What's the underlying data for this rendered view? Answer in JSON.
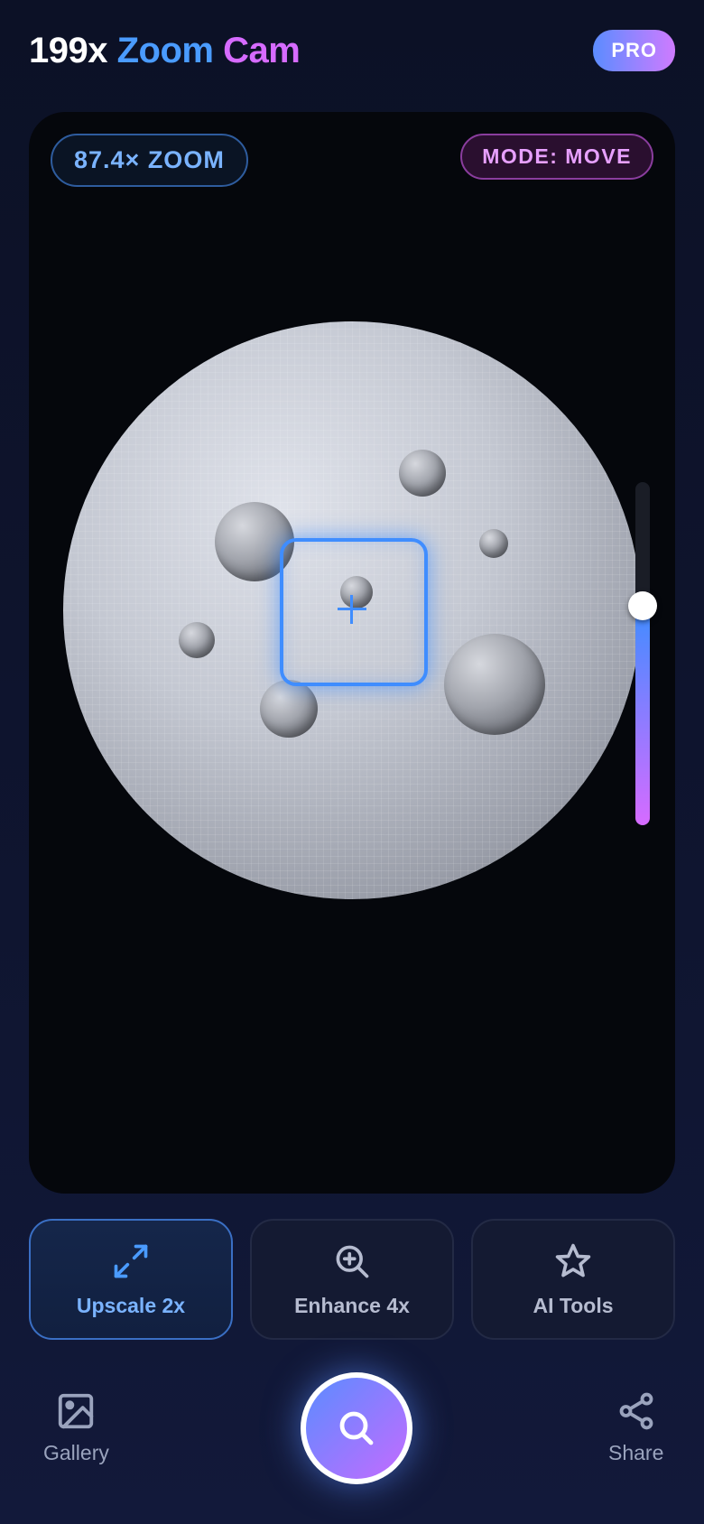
{
  "app": {
    "title_part1": "199x",
    "title_part2": "Zoom",
    "title_part3": "Cam",
    "badge": "PRO"
  },
  "viewer": {
    "zoom_label": "87.4× ZOOM",
    "mode_label": "MODE: MOVE",
    "zoom_slider_level": 0.64
  },
  "tools": [
    {
      "label": "Upscale 2x",
      "icon": "expand-arrows-icon",
      "active": true
    },
    {
      "label": "Enhance 4x",
      "icon": "zoom-in-icon",
      "active": false
    },
    {
      "label": "AI Tools",
      "icon": "star-icon",
      "active": false
    }
  ],
  "bottom_nav": {
    "left_label": "Gallery",
    "left_icon": "image-icon",
    "center_icon": "search-icon",
    "right_label": "Share",
    "right_icon": "share-icon"
  },
  "colors": {
    "accent_blue": "#4a9bff",
    "accent_purple": "#d66bff",
    "background": "#0c1126"
  }
}
